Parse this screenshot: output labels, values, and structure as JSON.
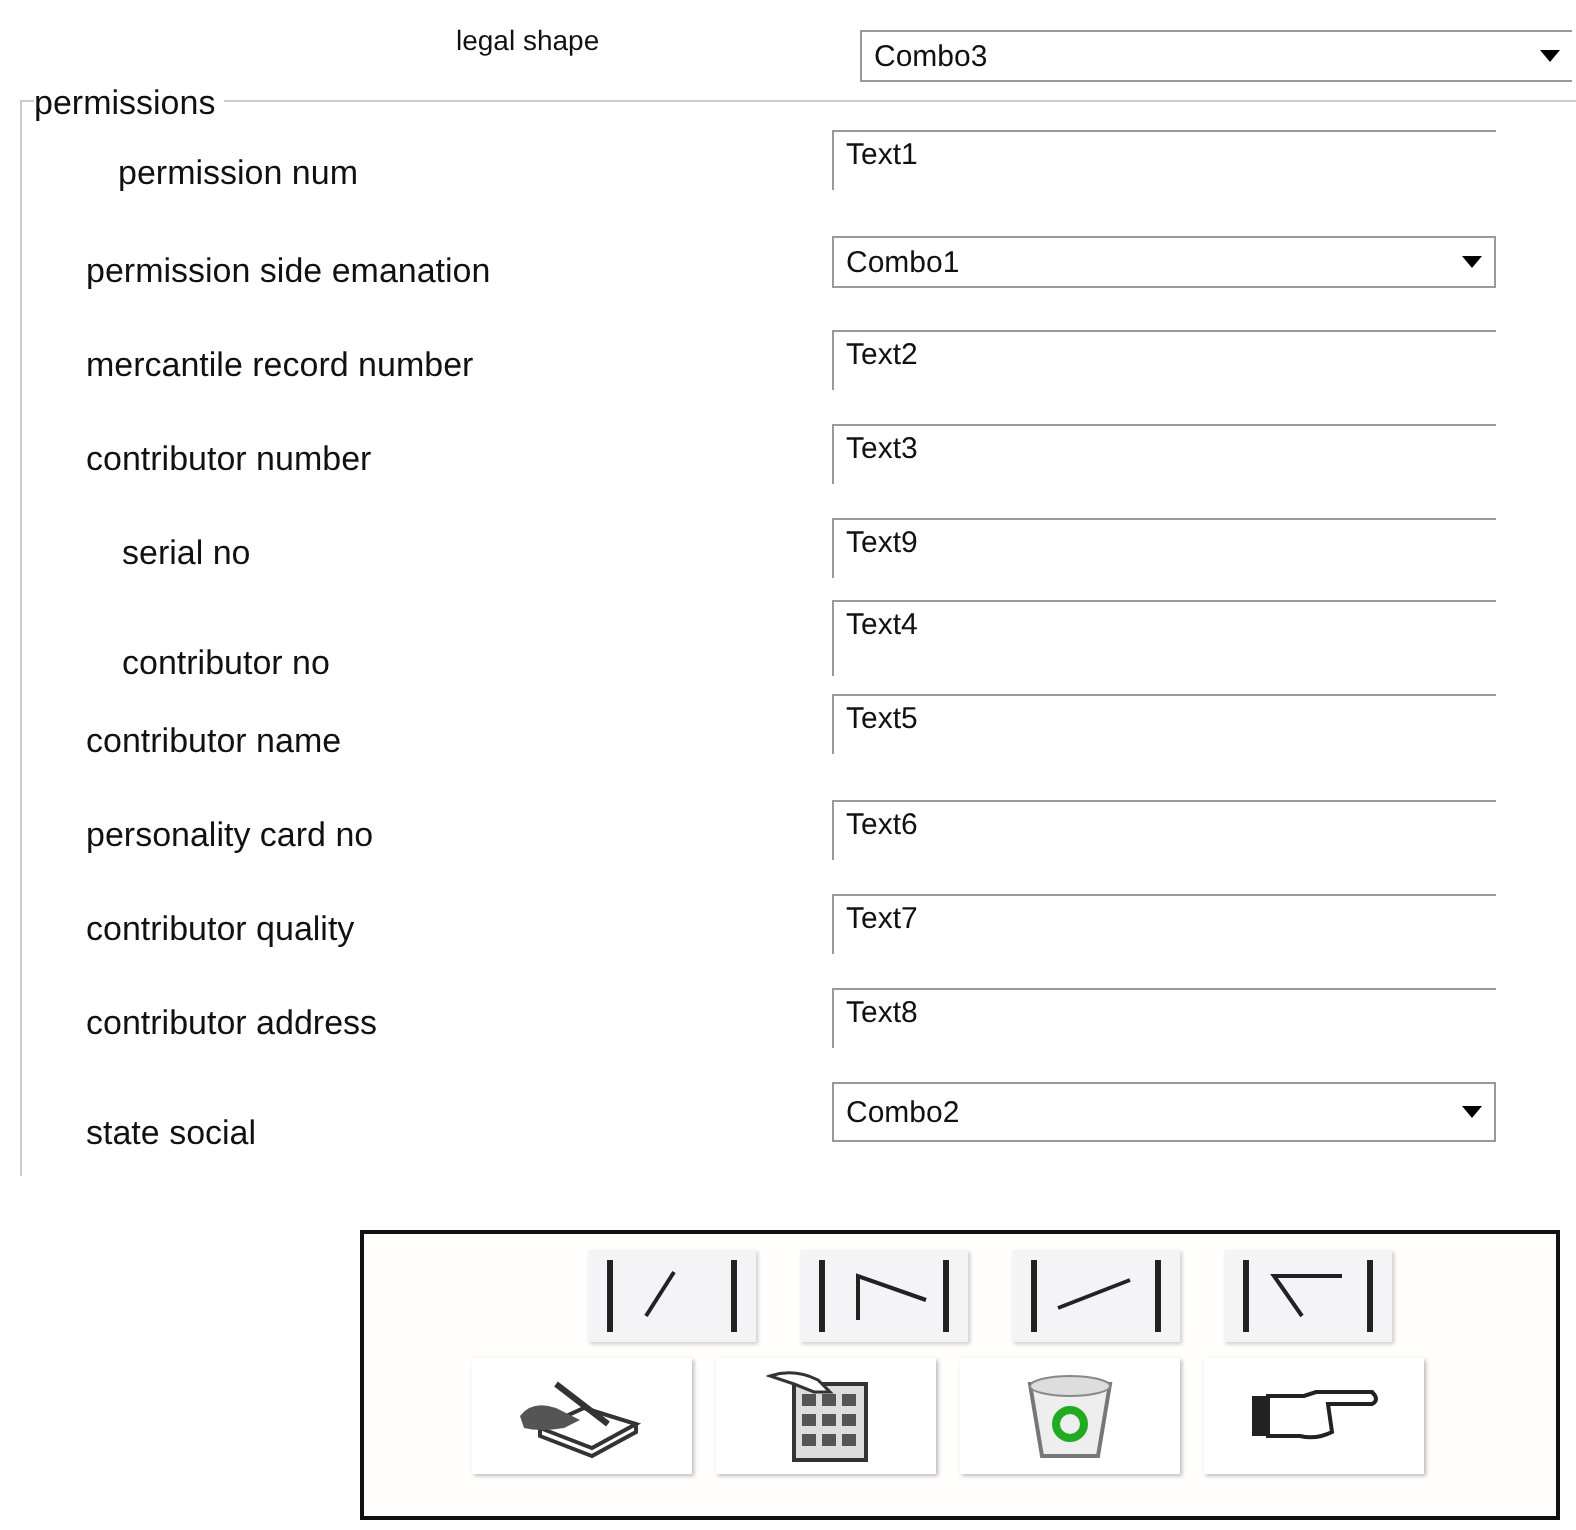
{
  "legal_shape": {
    "label": "legal shape",
    "value": "Combo3"
  },
  "permissions": {
    "title": "permissions",
    "rows": [
      {
        "label": "permission num",
        "kind": "text",
        "value": "Text1"
      },
      {
        "label": "permission side emanation",
        "kind": "combo",
        "value": "Combo1"
      },
      {
        "label": "mercantile record number",
        "kind": "text",
        "value": "Text2"
      },
      {
        "label": "contributor  number",
        "kind": "text",
        "value": "Text3"
      },
      {
        "label": "serial no",
        "kind": "text",
        "value": "Text9"
      },
      {
        "label": "contributor no",
        "kind": "text",
        "value": "Text4"
      },
      {
        "label": "contributor name",
        "kind": "text",
        "value": "Text5"
      },
      {
        "label": "personality card no",
        "kind": "text",
        "value": "Text6"
      },
      {
        "label": "contributor quality",
        "kind": "text",
        "value": "Text7"
      },
      {
        "label": "contributor address",
        "kind": "text",
        "value": "Text8"
      },
      {
        "label": "state social",
        "kind": "combo",
        "value": "Combo2"
      }
    ]
  },
  "toolbar": {
    "nav_buttons": [
      {
        "kind": "first"
      },
      {
        "kind": "previous"
      },
      {
        "kind": "next"
      },
      {
        "kind": "last"
      }
    ],
    "action_buttons": [
      {
        "kind": "edit"
      },
      {
        "kind": "keypad"
      },
      {
        "kind": "delete"
      },
      {
        "kind": "point"
      }
    ]
  }
}
